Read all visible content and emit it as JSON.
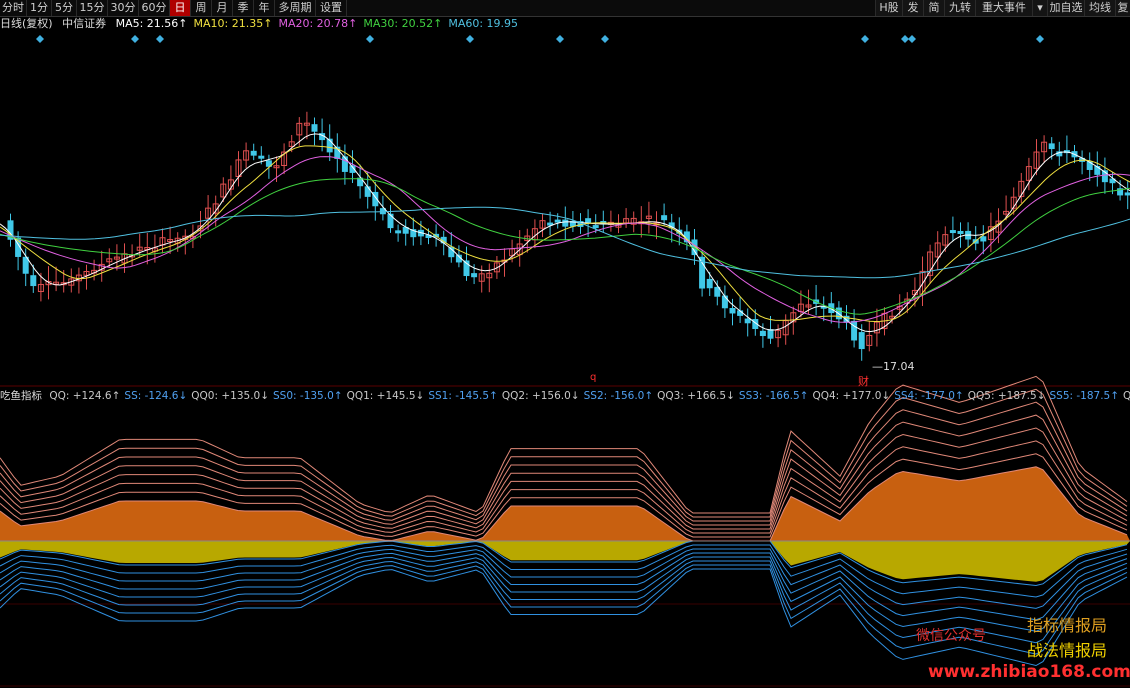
{
  "topbar": {
    "tabs": [
      {
        "label": "分时",
        "active": false
      },
      {
        "label": "1分",
        "active": false
      },
      {
        "label": "5分",
        "active": false
      },
      {
        "label": "15分",
        "active": false
      },
      {
        "label": "30分",
        "active": false
      },
      {
        "label": "60分",
        "active": false
      },
      {
        "label": "日",
        "active": true
      },
      {
        "label": "周",
        "active": false
      },
      {
        "label": "月",
        "active": false
      },
      {
        "label": "季",
        "active": false
      },
      {
        "label": "年",
        "active": false
      },
      {
        "label": "多周期",
        "active": false
      },
      {
        "label": "设置",
        "active": false
      }
    ],
    "right_tabs": [
      "H股",
      "发",
      "简",
      "九转",
      "重大事件",
      "▾",
      "加自选",
      "均线",
      "复"
    ]
  },
  "price_header": {
    "period": "日线(复权)",
    "stock": "中信证券",
    "ma": [
      {
        "label": "MA5: 21.56↑",
        "color": "#ffffff"
      },
      {
        "label": "MA10: 21.35↑",
        "color": "#f0e040"
      },
      {
        "label": "MA20: 20.78↑",
        "color": "#e060e0"
      },
      {
        "label": "MA30: 20.52↑",
        "color": "#40d040"
      },
      {
        "label": "MA60: 19.95",
        "color": "#50c0e0"
      }
    ]
  },
  "price_annotations": {
    "low_label": "17.04",
    "cai_label": "财",
    "q_label": "q"
  },
  "indicator_header": {
    "name": "吃鱼指标",
    "items": [
      {
        "label": "QQ: +124.6↑",
        "color": "#c8c8c8"
      },
      {
        "label": "SS: -124.6↓",
        "color": "#50a0f0"
      },
      {
        "label": "QQ0: +135.0↓",
        "color": "#c8c8c8"
      },
      {
        "label": "SS0: -135.0↑",
        "color": "#50a0f0"
      },
      {
        "label": "QQ1: +145.5↓",
        "color": "#c8c8c8"
      },
      {
        "label": "SS1: -145.5↑",
        "color": "#50a0f0"
      },
      {
        "label": "QQ2: +156.0↓",
        "color": "#c8c8c8"
      },
      {
        "label": "SS2: -156.0↑",
        "color": "#50a0f0"
      },
      {
        "label": "QQ3: +166.5↓",
        "color": "#c8c8c8"
      },
      {
        "label": "SS3: -166.5↑",
        "color": "#50a0f0"
      },
      {
        "label": "QQ4: +177.0↓",
        "color": "#c8c8c8"
      },
      {
        "label": "SS4: -177.0↑",
        "color": "#50a0f0"
      },
      {
        "label": "QQ5: +187.5↓",
        "color": "#c8c8c8"
      },
      {
        "label": "SS5: -187.5↑",
        "color": "#50a0f0"
      },
      {
        "label": "QQ",
        "color": "#c8c8c8"
      }
    ]
  },
  "watermark": {
    "wechat": "微信公众号",
    "line1": "指标情报局",
    "line2": "战法情报局",
    "url": "www.zhibiao168.com"
  },
  "colors": {
    "up": "#e05050",
    "down": "#40c8e8",
    "ma5": "#ffffff",
    "ma10": "#f0e040",
    "ma20": "#e060e0",
    "ma30": "#40d040",
    "ma60": "#50c0e0",
    "pos_fill": "#c86010",
    "neg_fill": "#b8a800",
    "pos_lines": "#e08878",
    "neg_lines": "#3090e0"
  }
}
